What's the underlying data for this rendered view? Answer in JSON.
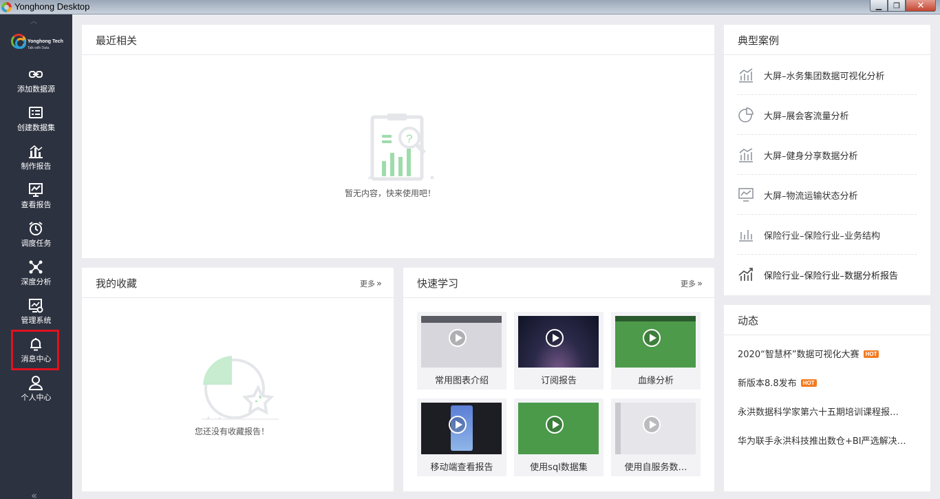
{
  "window": {
    "title": "Yonghong Desktop",
    "minimize": "▁",
    "maximize": "❐",
    "close": "✕"
  },
  "sidebar": {
    "logo": {
      "brand": "Yonghong Tech",
      "slogan": "Talk with Data"
    },
    "items": [
      {
        "label": "添加数据源",
        "icon": "link-icon"
      },
      {
        "label": "创建数据集",
        "icon": "dataset-icon"
      },
      {
        "label": "制作报告",
        "icon": "bar-chart-icon"
      },
      {
        "label": "查看报告",
        "icon": "monitor-chart-icon"
      },
      {
        "label": "调度任务",
        "icon": "alarm-clock-icon"
      },
      {
        "label": "深度分析",
        "icon": "network-icon"
      },
      {
        "label": "管理系统",
        "icon": "admin-settings-icon"
      },
      {
        "label": "消息中心",
        "icon": "bell-icon"
      },
      {
        "label": "个人中心",
        "icon": "user-icon"
      }
    ],
    "active_item": "消息中心",
    "collapse_glyph": "«"
  },
  "recent": {
    "title": "最近相关",
    "empty_text": "暂无内容，快来使用吧！"
  },
  "favorites": {
    "title": "我的收藏",
    "more": "更多",
    "more_glyph": "»",
    "empty_text": "您还没有收藏报告！"
  },
  "learning": {
    "title": "快速学习",
    "more": "更多",
    "more_glyph": "»",
    "videos": [
      {
        "label": "常用图表介绍"
      },
      {
        "label": "订阅报告"
      },
      {
        "label": "血缘分析"
      },
      {
        "label": "移动端查看报告"
      },
      {
        "label": "使用sql数据集"
      },
      {
        "label": "使用自服务数…"
      }
    ]
  },
  "cases": {
    "title": "典型案例",
    "items": [
      {
        "label": "大屏–水务集团数据可视化分析",
        "icon": "bar-trend-icon"
      },
      {
        "label": "大屏–展会客流量分析",
        "icon": "pie-chart-icon"
      },
      {
        "label": "大屏–健身分享数据分析",
        "icon": "bar-trend-icon"
      },
      {
        "label": "大屏–物流运输状态分析",
        "icon": "monitor-chart-icon"
      },
      {
        "label": "保险行业–保险行业–业务结构",
        "icon": "bar-chart-icon"
      },
      {
        "label": "保险行业–保险行业–数据分析报告",
        "icon": "bar-trend-icon"
      }
    ]
  },
  "news": {
    "title": "动态",
    "hot_label": "HOT",
    "items": [
      {
        "text": "2020“智慧杯”数据可视化大赛",
        "hot": true
      },
      {
        "text": "新版本8.8发布",
        "hot": true
      },
      {
        "text": "永洪数据科学家第六十五期培训课程报…",
        "hot": false
      },
      {
        "text": "华为联手永洪科技推出数仓+BI严选解决…",
        "hot": false
      }
    ]
  },
  "colors": {
    "sidebar_bg": "#2d3240",
    "accent_green": "#6bbf3a",
    "hot_badge": "#f47b20",
    "active_outline": "#e0121f"
  }
}
